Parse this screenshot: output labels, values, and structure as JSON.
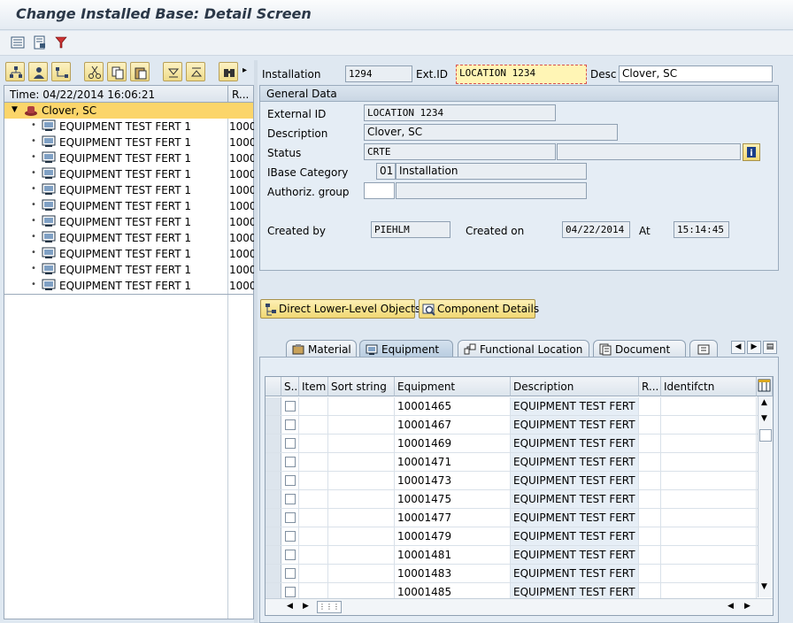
{
  "window": {
    "title": "Change Installed Base: Detail Screen"
  },
  "tree": {
    "time_header": "Time: 04/22/2014 16:06:21",
    "col2_header": "R...",
    "root": {
      "label": "Clover, SC"
    },
    "items": [
      {
        "label": "EQUIPMENT TEST FERT 1",
        "value": "1000"
      },
      {
        "label": "EQUIPMENT TEST FERT 1",
        "value": "1000"
      },
      {
        "label": "EQUIPMENT TEST FERT 1",
        "value": "1000"
      },
      {
        "label": "EQUIPMENT TEST FERT 1",
        "value": "1000"
      },
      {
        "label": "EQUIPMENT TEST FERT 1",
        "value": "1000"
      },
      {
        "label": "EQUIPMENT TEST FERT 1",
        "value": "1000"
      },
      {
        "label": "EQUIPMENT TEST FERT 1",
        "value": "1000"
      },
      {
        "label": "EQUIPMENT TEST FERT 1",
        "value": "1000"
      },
      {
        "label": "EQUIPMENT TEST FERT 1",
        "value": "1000"
      },
      {
        "label": "EQUIPMENT TEST FERT 1",
        "value": "1000"
      },
      {
        "label": "EQUIPMENT TEST FERT 1",
        "value": "1000"
      }
    ]
  },
  "header": {
    "installation_label": "Installation",
    "installation_value": "1294",
    "extid_label": "Ext.ID",
    "extid_value": "LOCATION 1234",
    "desc_label": "Desc",
    "desc_value": "Clover, SC"
  },
  "general_data": {
    "title": "General Data",
    "external_id_label": "External ID",
    "external_id_value": "LOCATION 1234",
    "description_label": "Description",
    "description_value": "Clover, SC",
    "status_label": "Status",
    "status_value": "CRTE",
    "ibase_category_label": "IBase Category",
    "ibase_category_code": "01",
    "ibase_category_text": "Installation",
    "authoriz_group_label": "Authoriz. group",
    "created_by_label": "Created by",
    "created_by_value": "PIEHLM",
    "created_on_label": "Created on",
    "created_on_value": "04/22/2014",
    "at_label": "At",
    "at_value": "15:14:45"
  },
  "buttons": {
    "direct_lower_level": "Direct Lower-Level Objects",
    "component_details": "Component Details"
  },
  "tabs": [
    {
      "label": "Material"
    },
    {
      "label": "Equipment"
    },
    {
      "label": "Functional Location"
    },
    {
      "label": "Document"
    }
  ],
  "table": {
    "columns": [
      "S...",
      "Item",
      "Sort string",
      "Equipment",
      "Description",
      "R...",
      "Identifctn"
    ],
    "rows": [
      {
        "equipment": "10001465",
        "description": "EQUIPMENT TEST FERT 1"
      },
      {
        "equipment": "10001467",
        "description": "EQUIPMENT TEST FERT 1"
      },
      {
        "equipment": "10001469",
        "description": "EQUIPMENT TEST FERT 1"
      },
      {
        "equipment": "10001471",
        "description": "EQUIPMENT TEST FERT 1"
      },
      {
        "equipment": "10001473",
        "description": "EQUIPMENT TEST FERT 1"
      },
      {
        "equipment": "10001475",
        "description": "EQUIPMENT TEST FERT 1"
      },
      {
        "equipment": "10001477",
        "description": "EQUIPMENT TEST FERT 1"
      },
      {
        "equipment": "10001479",
        "description": "EQUIPMENT TEST FERT 1"
      },
      {
        "equipment": "10001481",
        "description": "EQUIPMENT TEST FERT 1"
      },
      {
        "equipment": "10001483",
        "description": "EQUIPMENT TEST FERT 1"
      },
      {
        "equipment": "10001485",
        "description": "EQUIPMENT TEST FERT 1"
      }
    ]
  },
  "colors": {
    "accent_yellow": "#fbd56a",
    "panel_blue": "#e5edf5",
    "focus_red": "#d9534f"
  }
}
